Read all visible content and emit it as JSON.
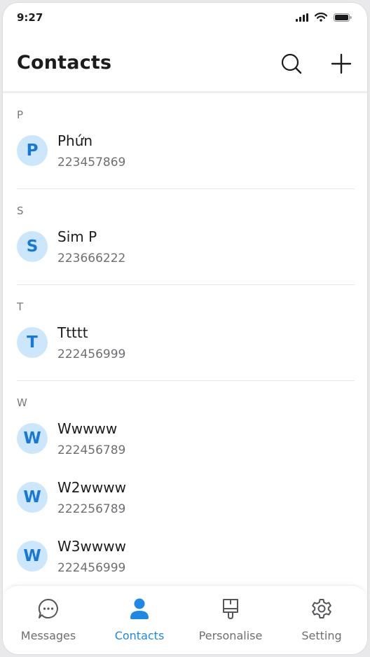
{
  "status_bar": {
    "time": "9:27"
  },
  "header": {
    "title": "Contacts"
  },
  "sections": [
    {
      "letter": "P",
      "contacts": [
        {
          "initial": "P",
          "name": "Phứn",
          "phone": "223457869"
        }
      ]
    },
    {
      "letter": "S",
      "contacts": [
        {
          "initial": "S",
          "name": "Sim P",
          "phone": "223666222"
        }
      ]
    },
    {
      "letter": "T",
      "contacts": [
        {
          "initial": "T",
          "name": "Ttttt",
          "phone": "222456999"
        }
      ]
    },
    {
      "letter": "W",
      "contacts": [
        {
          "initial": "W",
          "name": "Wwwww",
          "phone": "222456789"
        },
        {
          "initial": "W",
          "name": "W2wwww",
          "phone": "222256789"
        },
        {
          "initial": "W",
          "name": "W3wwww",
          "phone": "222456999"
        }
      ]
    }
  ],
  "tabs": [
    {
      "label": "Messages",
      "icon": "chat-bubble-icon",
      "active": false
    },
    {
      "label": "Contacts",
      "icon": "person-icon",
      "active": true
    },
    {
      "label": "Personalise",
      "icon": "brush-icon",
      "active": false
    },
    {
      "label": "Setting",
      "icon": "gear-icon",
      "active": false
    }
  ],
  "colors": {
    "accent": "#1e88e5",
    "avatar_bg": "#cce7fb",
    "avatar_text": "#1878d6"
  }
}
